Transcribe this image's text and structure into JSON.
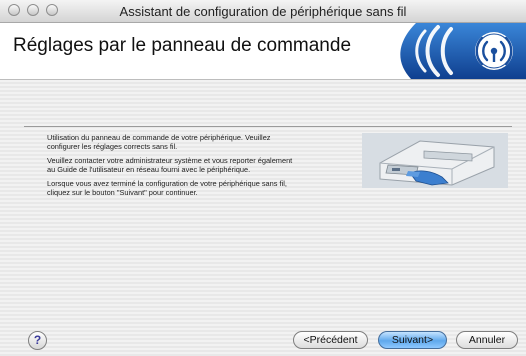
{
  "window": {
    "title": "Assistant de configuration de périphérique sans fil"
  },
  "header": {
    "title": "Réglages par le panneau de commande"
  },
  "body": {
    "paragraphs": [
      "Utilisation du panneau de commande de votre périphérique. Veuillez configurer les réglages corrects sans fil.",
      "Veuillez contacter votre administrateur système et vous reporter également au Guide de l'utilisateur en réseau fourni avec le périphérique.",
      "Lorsque vous avez terminé la configuration de votre périphérique sans fil, cliquez sur le bouton \"Suivant\" pour continuer."
    ]
  },
  "buttons": {
    "help": "?",
    "previous": "<Précédent",
    "next": "Suivant>",
    "cancel": "Annuler"
  },
  "icons": {
    "window_controls": [
      "close-icon",
      "minimize-icon",
      "zoom-icon"
    ],
    "banner": "wireless-signal-icon",
    "illustration": "printer-control-panel-image"
  },
  "colors": {
    "banner_blue": "#1f5fb8",
    "default_button": "#5fa8ec"
  }
}
